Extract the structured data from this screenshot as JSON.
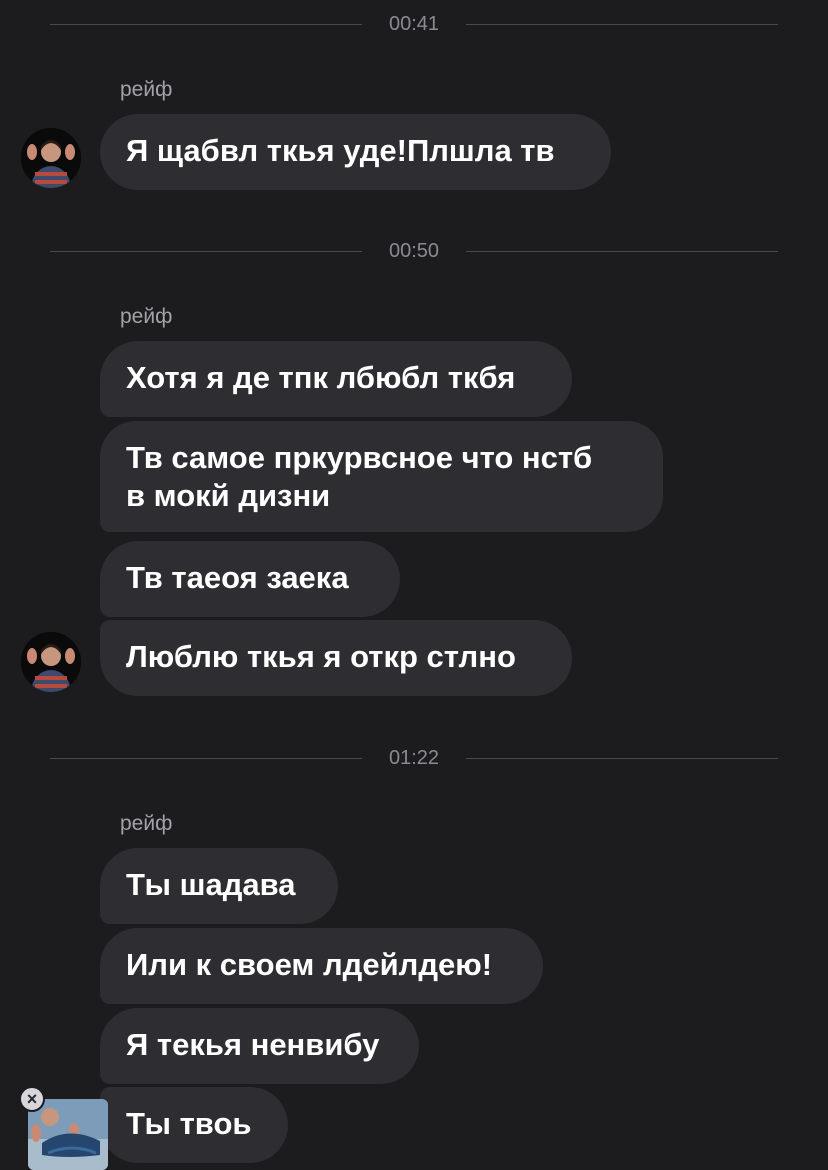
{
  "messages": {
    "groups": [
      {
        "time": "00:41",
        "sender": "рейф",
        "bubbles": [
          "Я щабвл ткья уде!Плшла тв"
        ]
      },
      {
        "time": "00:50",
        "sender": "рейф",
        "bubbles": [
          "Хотя я де тпк лбюбл ткбя",
          "Тв самое пркурвсное что нстб",
          "в мокй дизни",
          "Тв таеоя заека",
          "Люблю ткья я откр стлно"
        ]
      },
      {
        "time": "01:22",
        "sender": "рейф",
        "bubbles": [
          "Ты шадава",
          "Или к своем лдейлдею!",
          "Я текья ненвибу",
          "Ты твоь"
        ]
      }
    ]
  },
  "colors": {
    "background": "#1c1b1e",
    "bubble": "#2e2d31",
    "divider": "#48474c",
    "timestamp": "#8b8a90",
    "sender": "#a3a2a8"
  },
  "icons": {
    "avatar": "user-avatar-photo",
    "attachment": "attachment-thumbnail",
    "remove": "close-icon"
  }
}
